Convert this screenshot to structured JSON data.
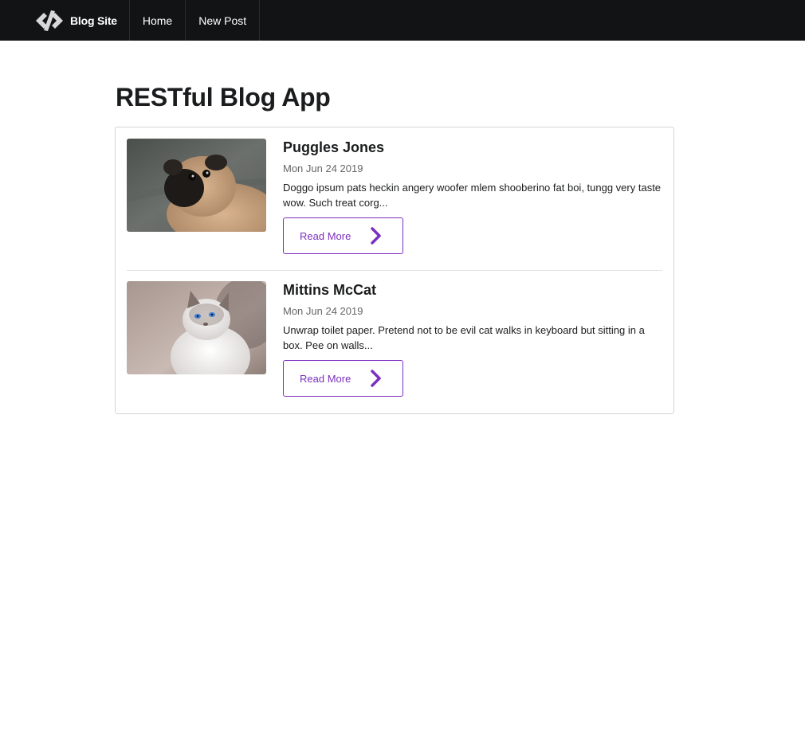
{
  "navbar": {
    "brand_icon": "code-icon",
    "brand_label": "Blog Site",
    "items": [
      {
        "label": "Home"
      },
      {
        "label": "New Post"
      }
    ]
  },
  "page": {
    "title": "RESTful Blog App"
  },
  "posts": [
    {
      "title": "Puggles Jones",
      "date": "Mon Jun 24 2019",
      "excerpt": "Doggo ipsum pats heckin angery woofer mlem shooberino fat boi, tungg very taste wow. Such treat corg...",
      "image": "pug-photo",
      "read_more_label": "Read More",
      "read_more_icon": "chevron-right-icon"
    },
    {
      "title": "Mittins McCat",
      "date": "Mon Jun 24 2019",
      "excerpt": "Unwrap toilet paper. Pretend not to be evil cat walks in keyboard but sitting in a box. Pee on walls...",
      "image": "cat-photo",
      "read_more_label": "Read More",
      "read_more_icon": "chevron-right-icon"
    }
  ],
  "colors": {
    "navbar_bg": "#121315",
    "accent": "#7b2fbf",
    "border": "#d4d4d5",
    "date_text": "#666666"
  }
}
